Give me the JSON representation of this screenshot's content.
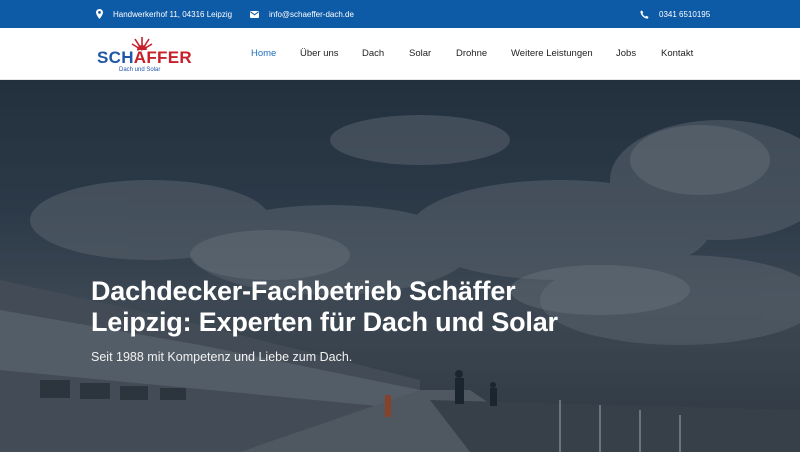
{
  "topbar": {
    "address": "Handwerkerhof 11, 04316 Leipzig",
    "email": "info@schaeffer-dach.de",
    "phone": "0341 6510195",
    "background_color": "#0d5aa7",
    "icons": {
      "address": "map-pin-icon",
      "email": "envelope-icon",
      "phone": "phone-icon"
    }
  },
  "logo": {
    "name_part1": "SCH",
    "name_part2": "FFER",
    "tagline": "Dach und Solar",
    "colors": {
      "blue": "#1f56a8",
      "red": "#c8202a"
    }
  },
  "nav": {
    "items": [
      {
        "label": "Home",
        "active": true
      },
      {
        "label": "Über uns",
        "active": false
      },
      {
        "label": "Dach",
        "active": false
      },
      {
        "label": "Solar",
        "active": false
      },
      {
        "label": "Drohne",
        "active": false
      },
      {
        "label": "Weitere Leistungen",
        "active": false
      },
      {
        "label": "Jobs",
        "active": false
      },
      {
        "label": "Kontakt",
        "active": false
      }
    ],
    "active_color": "#1f6fc0"
  },
  "hero": {
    "title_line1": "Dachdecker-Fachbetrieb Schäffer",
    "title_line2": "Leipzig: Experten für Dach und Solar",
    "subtitle": "Seit 1988 mit Kompetenz und Liebe zum Dach."
  }
}
